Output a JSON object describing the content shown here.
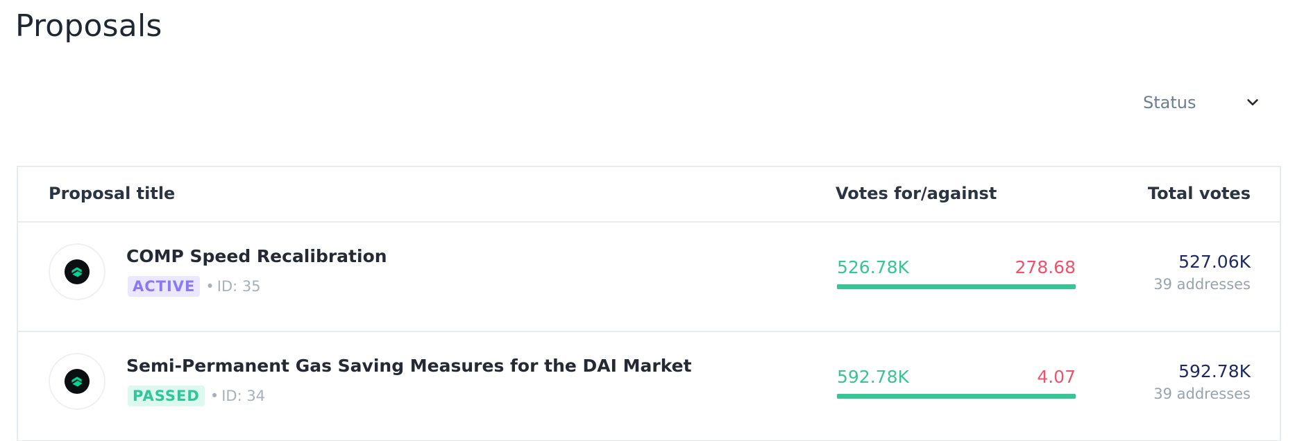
{
  "page": {
    "title": "Proposals"
  },
  "filter": {
    "status_label": "Status",
    "chevron_icon": "chevron-down-icon"
  },
  "table": {
    "headers": {
      "title": "Proposal title",
      "votes": "Votes for/against",
      "total": "Total votes"
    },
    "rows": [
      {
        "icon": "compound-icon",
        "title": "COMP Speed Recalibration",
        "status": "ACTIVE",
        "id_text": "ID: 35",
        "votes_for": "526.78K",
        "votes_against": "278.68",
        "for_fraction": 0.9995,
        "total_votes": "527.06K",
        "addresses": "39 addresses"
      },
      {
        "icon": "compound-icon",
        "title": "Semi-Permanent Gas Saving Measures for the DAI Market",
        "status": "PASSED",
        "id_text": "ID: 34",
        "votes_for": "592.78K",
        "votes_against": "4.07",
        "for_fraction": 1.0,
        "total_votes": "592.78K",
        "addresses": "39 addresses"
      }
    ]
  },
  "colors": {
    "for": "#37c596",
    "against": "#f0516b",
    "active_badge": "#8a79f2",
    "passed_badge": "#2fc79a",
    "total_amount": "#1e2a62"
  }
}
